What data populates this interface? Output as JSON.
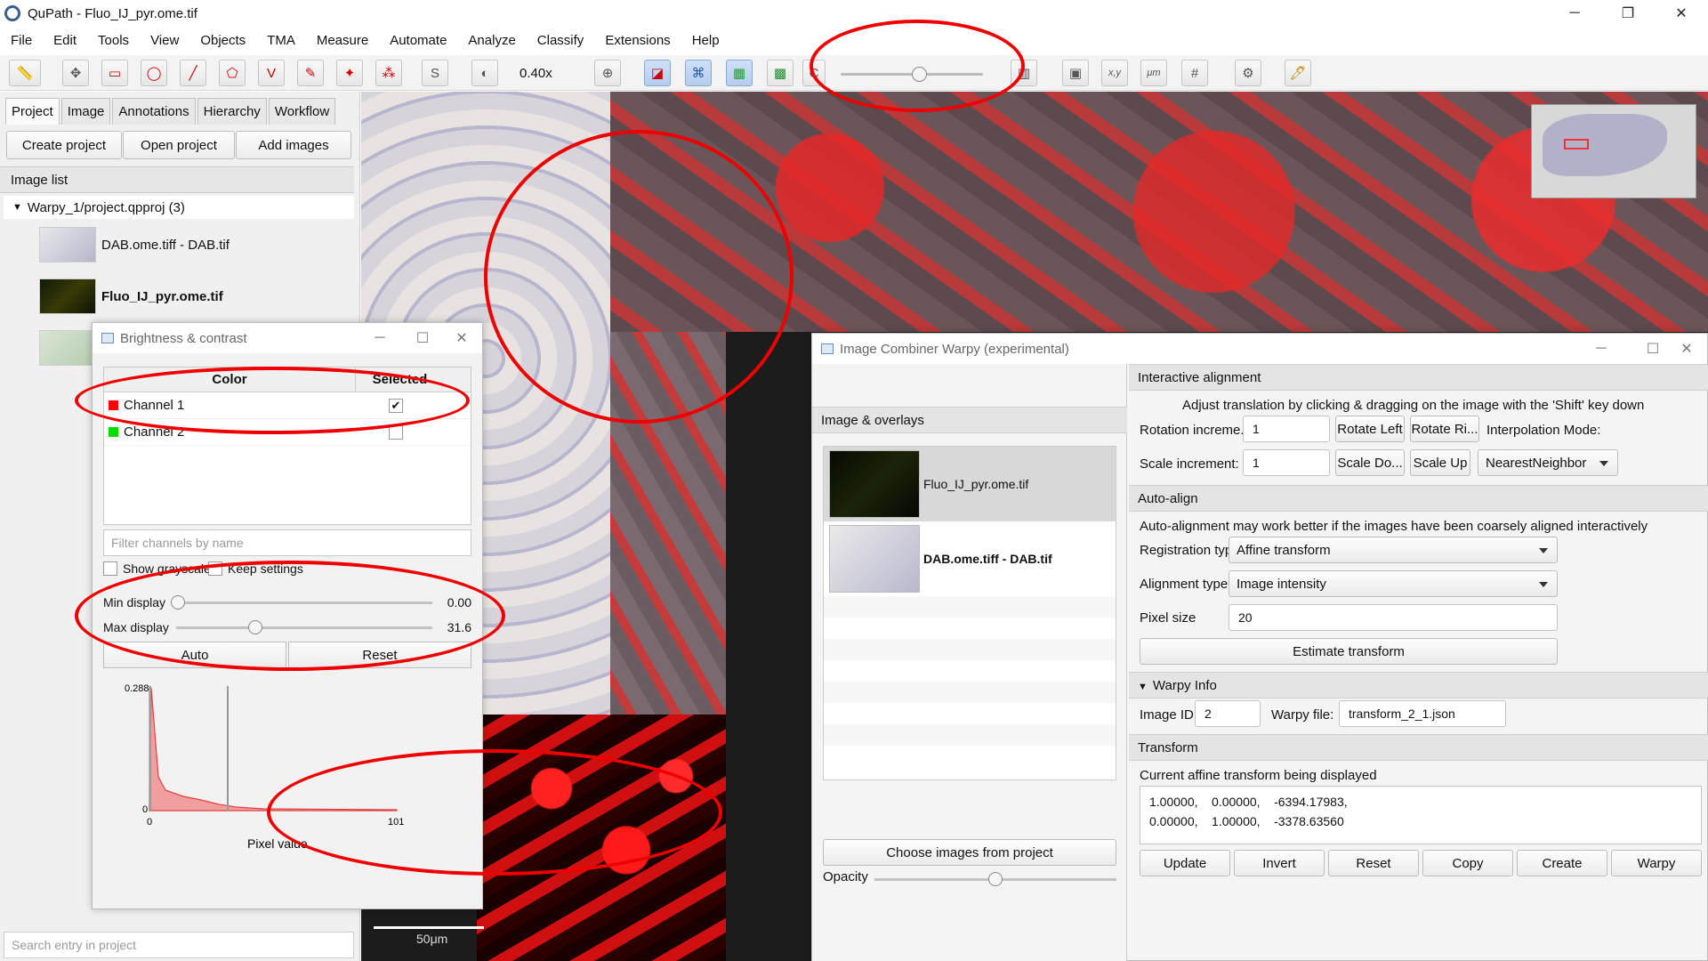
{
  "window": {
    "title": "QuPath - Fluo_IJ_pyr.ome.tif",
    "minimize": "─",
    "restore": "❐",
    "close": "✕"
  },
  "menu": [
    "File",
    "Edit",
    "Tools",
    "View",
    "Objects",
    "TMA",
    "Measure",
    "Automate",
    "Analyze",
    "Classify",
    "Extensions",
    "Help"
  ],
  "toolbar": {
    "zoom": "0.40x",
    "xy_label": "x,y",
    "um_label": "μm",
    "s_label": "S",
    "c_label": "C"
  },
  "left_panel": {
    "tabs": [
      "Project",
      "Image",
      "Annotations",
      "Hierarchy",
      "Workflow"
    ],
    "buttons": [
      "Create project",
      "Open project",
      "Add images"
    ],
    "image_list_label": "Image list",
    "project_root": "Warpy_1/project.qpproj (3)",
    "items": [
      "DAB.ome.tiff - DAB.tif",
      "Fluo_IJ_pyr.ome.tif"
    ],
    "search_placeholder": "Search entry in project"
  },
  "viewer": {
    "scalebar": "50μm"
  },
  "brightness_contrast": {
    "title": "Brightness & contrast",
    "col_color": "Color",
    "col_selected": "Selected",
    "channels": [
      {
        "name": "Channel 1",
        "color": "#ff0000",
        "selected": true
      },
      {
        "name": "Channel 2",
        "color": "#00ff00",
        "selected": false
      }
    ],
    "filter_placeholder": "Filter channels by name",
    "show_grayscale": "Show grayscale",
    "keep_settings": "Keep settings",
    "min_label": "Min display",
    "min_value": "0.00",
    "max_label": "Max display",
    "max_value": "31.6",
    "auto": "Auto",
    "reset": "Reset",
    "hist_ymax": "0.288",
    "hist_y0": "0",
    "hist_x0": "0",
    "hist_xmax": "101",
    "hist_xlabel": "Pixel value"
  },
  "warpy": {
    "title": "Image Combiner Warpy (experimental)",
    "overlays_label": "Image & overlays",
    "overlays": [
      "Fluo_IJ_pyr.ome.tif",
      "DAB.ome.tiff - DAB.tif"
    ],
    "choose_images": "Choose images from project",
    "opacity_label": "Opacity",
    "interactive_header": "Interactive alignment",
    "interactive_hint": "Adjust translation by clicking & dragging on the image with the 'Shift' key down",
    "rotation_label": "Rotation increme...",
    "rotation_value": "1",
    "rotate_left": "Rotate Left",
    "rotate_right": "Rotate Ri...",
    "interp_label": "Interpolation Mode:",
    "scale_label": "Scale increment:",
    "scale_value": "1",
    "scale_down": "Scale Do...",
    "scale_up": "Scale Up",
    "interp_value": "NearestNeighbor",
    "autoalign_header": "Auto-align",
    "autoalign_hint": "Auto-alignment may work better if the images have been coarsely aligned interactively",
    "registration_label": "Registration type",
    "registration_value": "Affine transform",
    "alignment_label": "Alignment type",
    "alignment_value": "Image intensity",
    "pixel_label": "Pixel size",
    "pixel_value": "20",
    "estimate": "Estimate transform",
    "info_header": "Warpy Info",
    "image_id_label": "Image ID:",
    "image_id_value": "2",
    "warpy_file_label": "Warpy file:",
    "warpy_file_value": "transform_2_1.json",
    "transform_header": "Transform",
    "transform_caption": "Current affine transform being displayed",
    "transform_text": "1.00000,    0.00000,    -6394.17983,\n0.00000,    1.00000,    -3378.63560",
    "buttons": [
      "Update",
      "Invert",
      "Reset",
      "Copy",
      "Create",
      "Warpy"
    ]
  }
}
